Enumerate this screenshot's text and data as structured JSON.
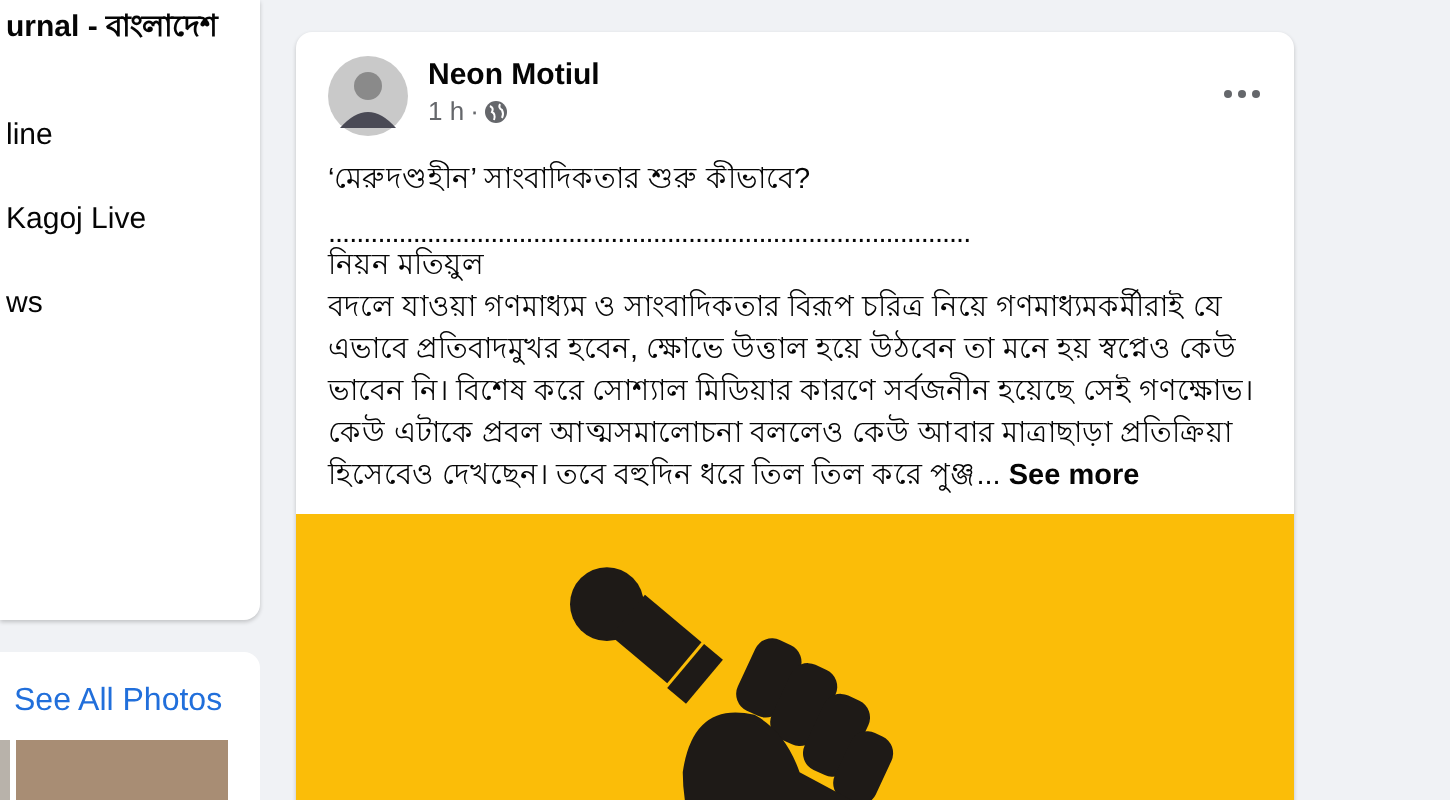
{
  "left_panel": {
    "items": [
      "urnal - বাংলাদেশ",
      "line",
      "Kagoj Live",
      "ws"
    ]
  },
  "photos_panel": {
    "link": "See All Photos"
  },
  "post": {
    "author": "Neon Motiul",
    "time": "1 h",
    "time_separator": "·",
    "title": "‘মেরুদণ্ডহীন’ সাংবাদিকতার শুরু কীভাবে?",
    "divider": "...........................................................................................",
    "byline": "নিয়ন মতিয়ুল",
    "body": "বদলে যাওয়া গণমাধ্যম ও সাংবাদিকতার বিরূপ চরিত্র নিয়ে গণমাধ্যমকর্মীরাই যে এভাবে প্রতিবাদমুখর হবেন, ক্ষোভে উত্তাল হয়ে উঠবেন তা মনে হয় স্বপ্নেও কেউ ভাবেন নি। বিশেষ করে সোশ্যাল মিডিয়ার কারণে সর্বজনীন হয়েছে সেই গণক্ষোভ। কেউ এটাকে প্রবল আত্মসমালোচনা বললেও কেউ আবার মাত্রাছাড়া প্রতিক্রিয়া হিসেবেও দেখছেন। তবে বহুদিন ধরে তিল তিল করে পুঞ্জ...",
    "see_more": "See more"
  }
}
